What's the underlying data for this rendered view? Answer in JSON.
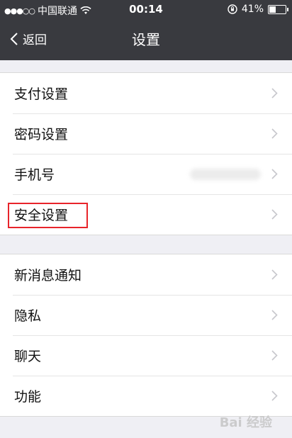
{
  "status_bar": {
    "signal": "●●●○○",
    "carrier": "中国联通",
    "time": "00:14",
    "battery": "41%"
  },
  "nav": {
    "back_label": "返回",
    "title": "设置"
  },
  "group1": [
    {
      "label": "支付设置"
    },
    {
      "label": "密码设置"
    },
    {
      "label": "手机号"
    },
    {
      "label": "安全设置"
    }
  ],
  "group2": [
    {
      "label": "新消息通知"
    },
    {
      "label": "隐私"
    },
    {
      "label": "聊天"
    },
    {
      "label": "功能"
    }
  ],
  "watermark": "Bai 经验"
}
